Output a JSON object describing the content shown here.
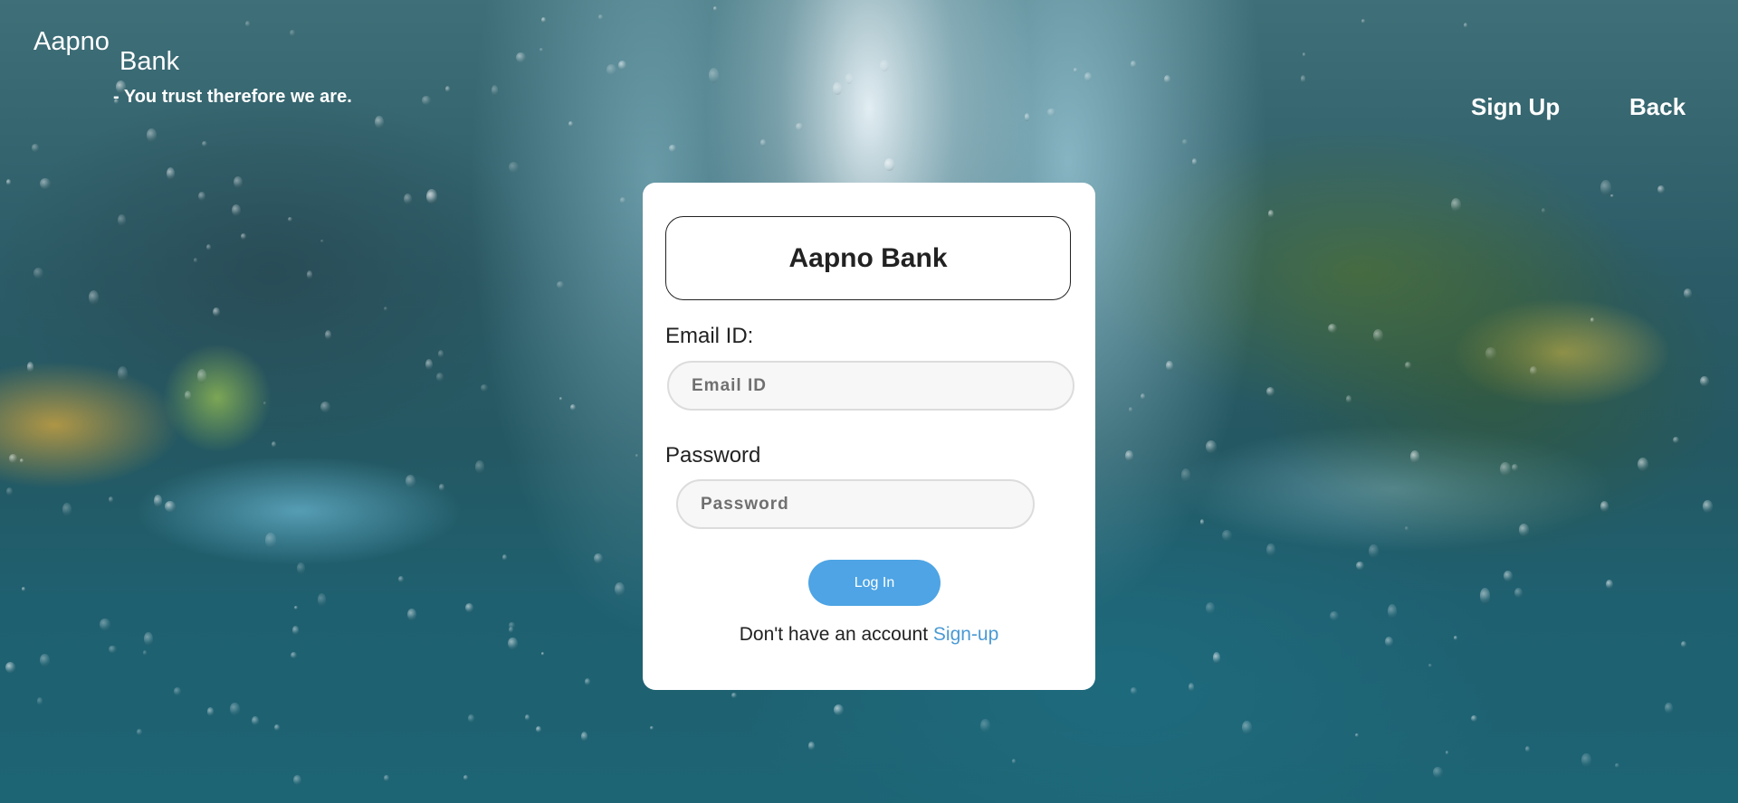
{
  "brand": {
    "word1": "Aapno",
    "word2": "Bank",
    "tagline": "- You trust therefore we are."
  },
  "nav": {
    "signup": "Sign Up",
    "back": "Back"
  },
  "login_card": {
    "title": "Aapno Bank",
    "email_label": "Email ID:",
    "email_placeholder": "Email ID",
    "email_value": "",
    "password_label": "Password",
    "password_placeholder": "Password",
    "password_value": "",
    "login_button": "Log In",
    "no_account_text": "Don't have an account",
    "signup_link": "Sign-up"
  },
  "colors": {
    "card_background": "#ffffff",
    "button_blue": "#4ea4e4",
    "link_blue": "#4a9ad4",
    "header_text": "#ffffff"
  }
}
